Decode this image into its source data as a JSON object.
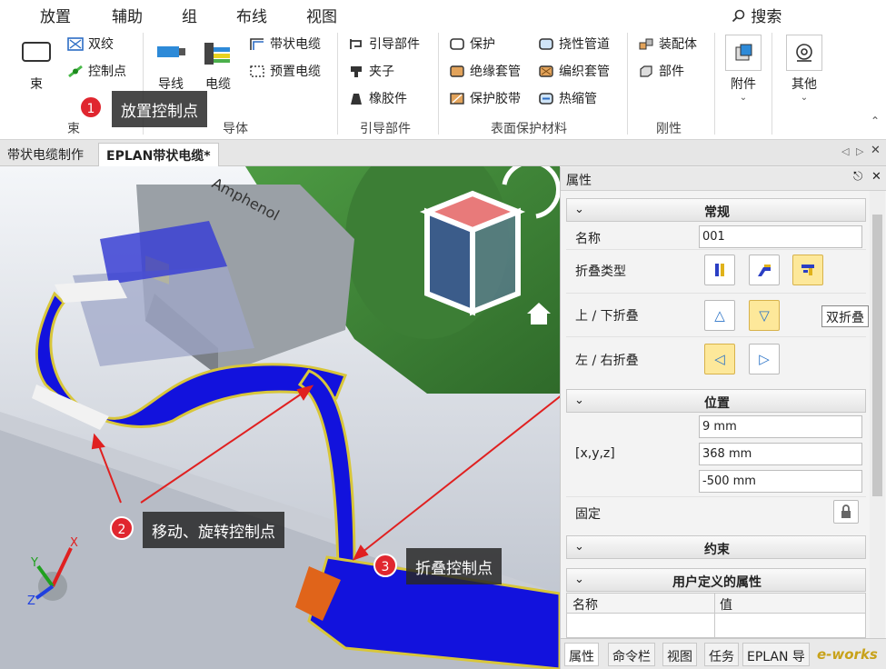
{
  "ribbon_tabs": [
    "放置",
    "辅助",
    "组",
    "布线",
    "视图"
  ],
  "search_label": "搜索",
  "groups": {
    "bundle": {
      "label": "束",
      "big": "束",
      "items": [
        "双绞",
        "控制点"
      ]
    },
    "conductor": {
      "label": "导体",
      "big": [
        "导线",
        "电缆"
      ],
      "items": [
        "带状电缆",
        "预置电缆"
      ]
    },
    "guide": {
      "label": "引导部件",
      "items": [
        "引导部件",
        "夹子",
        "橡胶件"
      ]
    },
    "protect": {
      "label": "表面保护材料",
      "items": [
        "保护",
        "绝缘套管",
        "保护胶带",
        "挠性管道",
        "编织套管",
        "热缩管"
      ]
    },
    "rigid": {
      "label": "刚性",
      "items": [
        "装配体",
        "部件"
      ]
    },
    "attach": {
      "label": "附件"
    },
    "other": {
      "label": "其他"
    }
  },
  "doc_tabs": [
    "带状电缆制作",
    "EPLAN带状电缆*"
  ],
  "viewport": {
    "brand_text": "Amphenol",
    "axes": [
      "X",
      "Y",
      "Z"
    ]
  },
  "properties": {
    "title": "属性",
    "sections": {
      "general": "常规",
      "position": "位置",
      "constraint": "约束",
      "user": "用户定义的属性"
    },
    "name_label": "名称",
    "name_value": "001",
    "fold_type_label": "折叠类型",
    "updown_label": "上 / 下折叠",
    "leftright_label": "左 / 右折叠",
    "xyz_label": "[x,y,z]",
    "x": "9 mm",
    "y": "368 mm",
    "z": "-500 mm",
    "fixed_label": "固定",
    "table_headers": [
      "名称",
      "值"
    ],
    "tooltip": "双折叠"
  },
  "bottom_tabs": [
    "属性",
    "命令栏",
    "视图",
    "任务",
    "EPLAN 导"
  ],
  "callouts": [
    {
      "num": "1",
      "text": "放置控制点"
    },
    {
      "num": "2",
      "text": "移动、旋转控制点"
    },
    {
      "num": "3",
      "text": "折叠控制点"
    }
  ],
  "watermark": "e-works",
  "colors": {
    "ribbon_blue": "#1f5fb3",
    "cable_blue": "#1010e0",
    "highlight": "#fde89a",
    "badge_red": "#e0262f"
  }
}
